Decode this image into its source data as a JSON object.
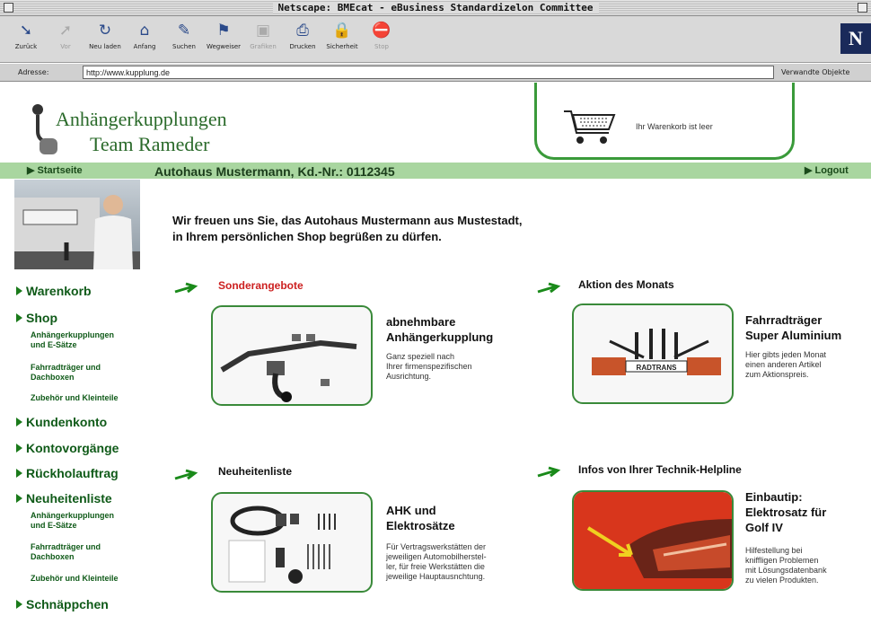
{
  "window": {
    "title": "Netscape: BMEcat - eBusiness Standardizelon Committee"
  },
  "toolbar": {
    "back": "Zurück",
    "forward": "Vor",
    "reload": "Neu laden",
    "home": "Anfang",
    "search": "Suchen",
    "guide": "Wegweiser",
    "images": "Grafiken",
    "print": "Drucken",
    "security": "Sicherheit",
    "stop": "Stop",
    "brand_letter": "N"
  },
  "addressbar": {
    "label": "Adresse:",
    "url": "http://www.kupplung.de",
    "related": "Verwandte Objekte"
  },
  "header": {
    "logo_line1": "Anhängerkupplungen",
    "logo_line2": "Team Rameder",
    "cart_status": "Ihr Warenkorb ist leer"
  },
  "topnav": {
    "home": "Startseite",
    "customer": "Autohaus Mustermann,  Kd.-Nr.: 0112345",
    "logout": "Logout"
  },
  "sidebar": {
    "cart": "Warenkorb",
    "shop": "Shop",
    "shop_sub1": "Anhängerkupplungen\nund E-Sätze",
    "shop_sub2": "Fahrradträger und\nDachboxen",
    "shop_sub3": "Zubehör und Kleinteile",
    "account": "Kundenkonto",
    "transactions": "Kontovorgänge",
    "returns": "Rückholauftrag",
    "news": "Neuheitenliste",
    "news_sub1": "Anhängerkupplungen\nund E-Sätze",
    "news_sub2": "Fahrradträger und\nDachboxen",
    "news_sub3": "Zubehör und Kleinteile",
    "bargains": "Schnäppchen"
  },
  "main": {
    "welcome_line1": "Wir freuen uns Sie, das Autohaus Mustermann aus Mustestadt,",
    "welcome_line2": "in Ihrem persönlichen Shop begrüßen zu dürfen.",
    "specials": {
      "heading": "Sonderangebote",
      "title": "abnehmbare\nAnhängerkupplung",
      "desc": "Ganz speziell nach\nIhrer firmenspezifischen\nAusrichtung."
    },
    "action": {
      "heading": "Aktion des Monats",
      "title": "Fahrradträger\nSuper Aluminium",
      "desc": "Hier gibts jeden Monat\neinen anderen Artikel\nzum Aktionspreis.",
      "img_text": "RADTRANS"
    },
    "news": {
      "heading": "Neuheitenliste",
      "title": "AHK und\nElektrosätze",
      "desc": "Für Vertragswerkstätten der\njeweiligen Automobilherstel-\nler, für freie Werkstätten die\njeweilige Hauptausnchtung."
    },
    "helpline": {
      "heading": "Infos von Ihrer Technik-Helpline",
      "title": "Einbautip:\nElektrosatz für\nGolf IV",
      "desc": "Hilfestellung bei\nkniffligen Problemen\nmit Lösungsdatenbank\nzu vielen Produkten."
    }
  }
}
